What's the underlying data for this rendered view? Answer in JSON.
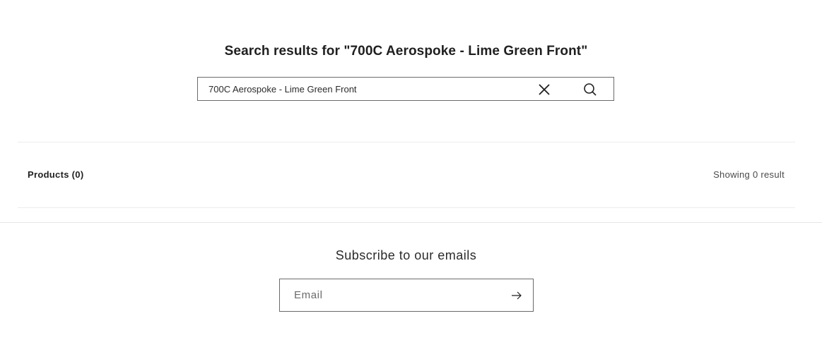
{
  "search": {
    "title": "Search results for \"700C Aerospoke - Lime Green Front\"",
    "query": "700C Aerospoke - Lime Green Front",
    "clear_icon": "close-icon",
    "submit_icon": "search-icon"
  },
  "results": {
    "label": "Products (0)",
    "count_text": "Showing 0 result"
  },
  "newsletter": {
    "title": "Subscribe to our emails",
    "email_placeholder": "Email",
    "submit_icon": "arrow-right-icon"
  },
  "colors": {
    "text": "#121212",
    "border": "#6a6a6a",
    "divider": "#ededed",
    "background": "#ffffff"
  }
}
